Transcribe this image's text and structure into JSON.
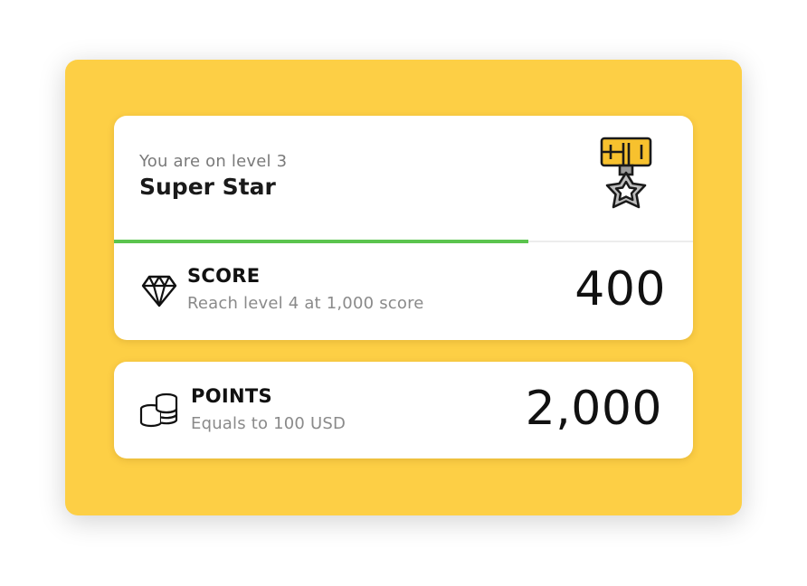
{
  "level": {
    "subtitle": "You are on level 3",
    "title": "Super Star",
    "medal_icon": "medal-star-icon",
    "progress_fraction": 0.715
  },
  "score": {
    "icon": "diamond-icon",
    "label": "SCORE",
    "description": "Reach level 4 at 1,000 score",
    "value": "400"
  },
  "points": {
    "icon": "coins-icon",
    "label": "POINTS",
    "description": "Equals to 100 USD",
    "value": "2,000"
  },
  "colors": {
    "background_panel": "#fdcf45",
    "progress": "#5bc44e",
    "medal_ribbon": "#f7c12e",
    "medal_star": "#bdbdbd"
  }
}
